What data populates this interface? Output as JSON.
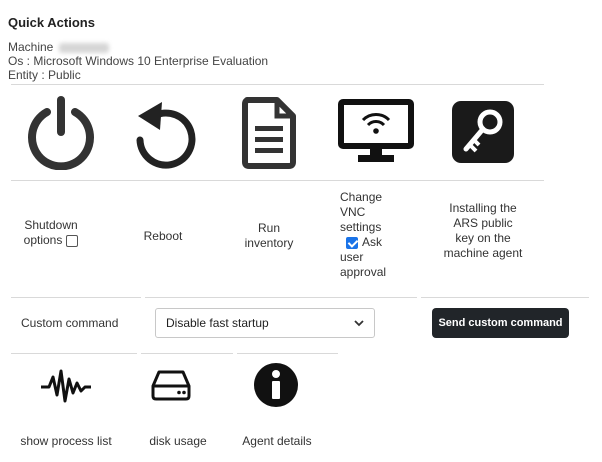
{
  "header": {
    "title": "Quick Actions",
    "machine_label": "Machine",
    "os_line": "Os : Microsoft Windows 10 Enterprise Evaluation",
    "entity_line": "Entity : Public"
  },
  "actions": [
    {
      "icon": "power-icon",
      "label": "Shutdown options",
      "checkbox_checked": false
    },
    {
      "icon": "reboot-icon",
      "label": "Reboot"
    },
    {
      "icon": "document-icon",
      "label": "Run inventory"
    },
    {
      "icon": "monitor-wifi-icon",
      "label_top": "Change VNC settings",
      "checkbox_label": "Ask user approval",
      "checkbox_checked": true
    },
    {
      "icon": "key-icon",
      "label": "Installing the ARS public key on the machine agent"
    }
  ],
  "custom_command": {
    "label": "Custom command",
    "selected": "Disable fast startup",
    "button": "Send custom command"
  },
  "tools": [
    {
      "icon": "waveform-icon",
      "label": "show process list"
    },
    {
      "icon": "disk-icon",
      "label": "disk usage"
    },
    {
      "icon": "info-icon",
      "label": "Agent details"
    }
  ]
}
